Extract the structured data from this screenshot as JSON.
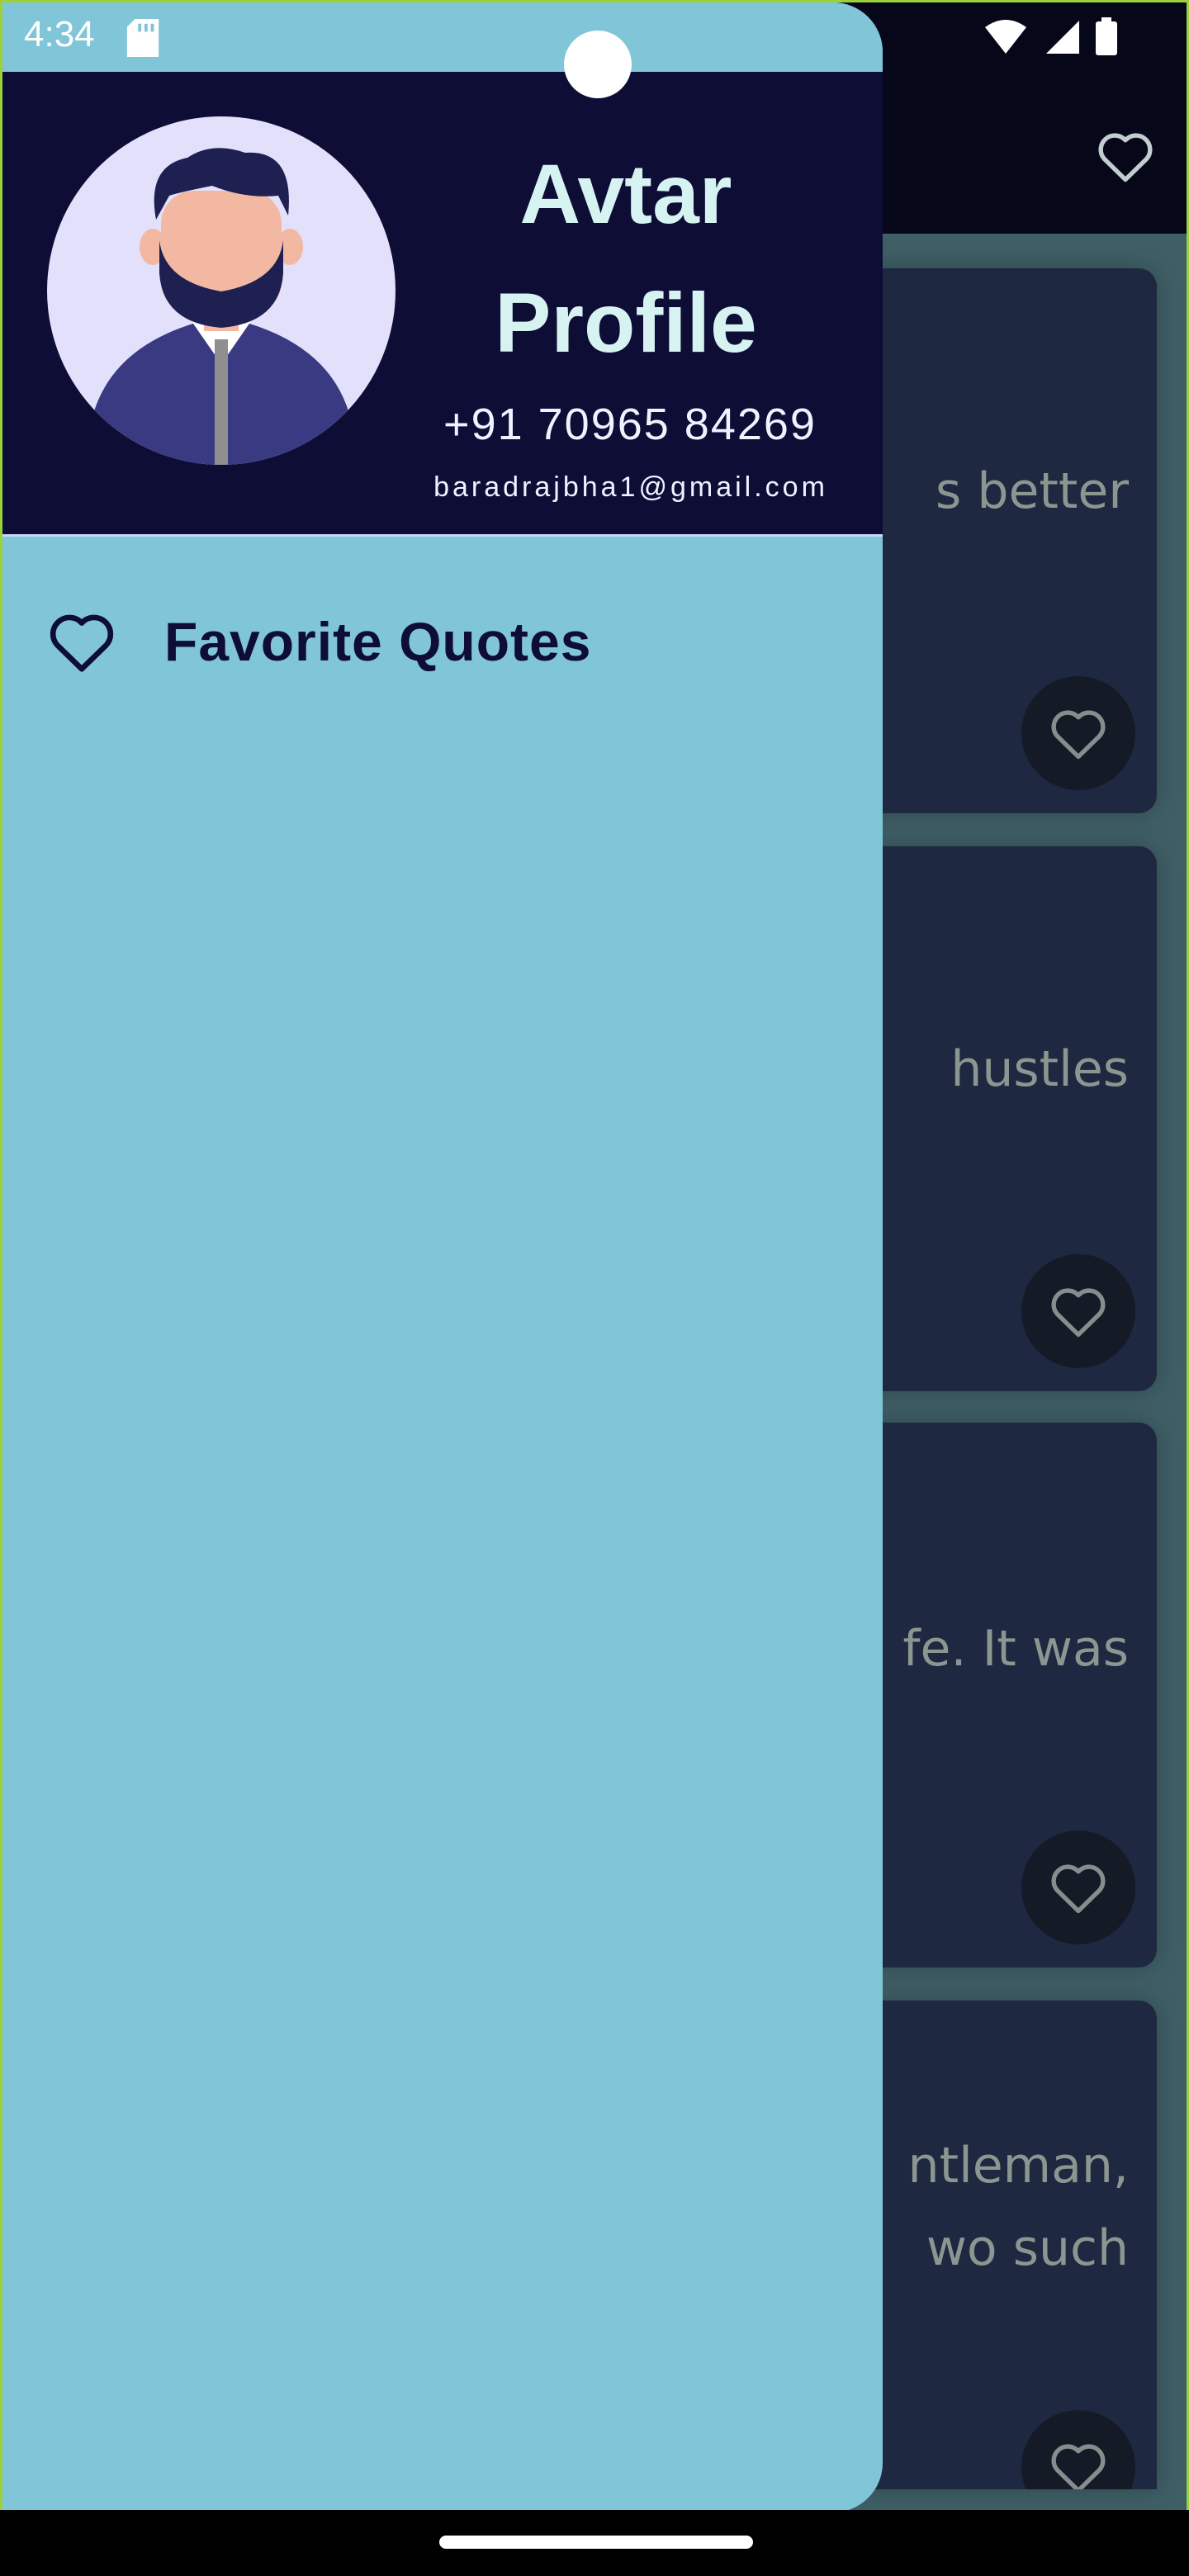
{
  "status_bar": {
    "time": "4:34"
  },
  "drawer": {
    "profile": {
      "name": "Avtar Profile",
      "phone": "+91 70965 84269",
      "email": "baradrajbha1@gmail.com"
    },
    "items": [
      {
        "label": "Favorite Quotes",
        "icon": "heart-outline-icon"
      }
    ]
  },
  "background": {
    "cards": [
      {
        "text": "s better"
      },
      {
        "text": "hustles"
      },
      {
        "text": "fe.  It was"
      },
      {
        "text": "ntleman,\nwo such"
      }
    ]
  },
  "colors": {
    "drawer_bg": "#80c5d8",
    "header_bg": "#0d0d36",
    "card_bg": "#1e2840",
    "accent_text": "#d7f3f1"
  }
}
